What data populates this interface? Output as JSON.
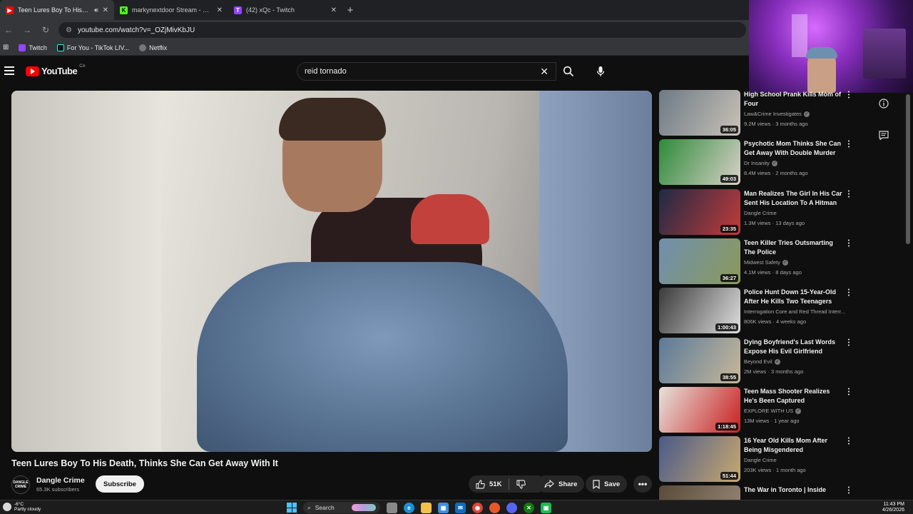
{
  "browser": {
    "tabs": [
      {
        "title": "Teen Lures Boy To His Death",
        "active": true,
        "icon": "youtube-favicon",
        "color": "#ff0000"
      },
      {
        "title": "markynextdoor Stream - Watch",
        "active": false,
        "icon": "kick-favicon",
        "color": "#53fc18"
      },
      {
        "title": "(42) xQc - Twitch",
        "active": false,
        "icon": "twitch-favicon",
        "color": "#9146ff"
      }
    ],
    "url": "youtube.com/watch?v=_OZjMivKbJU",
    "bookmarks": [
      {
        "label": "Twitch",
        "color": "#9146ff"
      },
      {
        "label": "For You - TikTok LIV...",
        "color": "#25f4ee"
      },
      {
        "label": "Netflix",
        "color": "#e50914"
      }
    ]
  },
  "youtube": {
    "logo_text": "YouTube",
    "country": "CA",
    "search_value": "reid tornado"
  },
  "video": {
    "title": "Teen Lures Boy To His Death, Thinks She Can Get Away With It",
    "channel": "Dangle Crime",
    "avatar_text": "DANGLE CRIME",
    "subscribers": "65.3K subscribers",
    "subscribe_label": "Subscribe",
    "likes": "51K",
    "share_label": "Share",
    "save_label": "Save"
  },
  "recommendations": [
    {
      "title": "High School Prank Kills Mom of Four",
      "channel": "Law&Crime Investigates",
      "verified": true,
      "views": "9.2M views",
      "age": "3 months ago",
      "duration": "36:05",
      "thumb": [
        "#6d7a86",
        "#c9c2b7"
      ]
    },
    {
      "title": "Psychotic Mom Thinks She Can Get Away With Double Murder",
      "channel": "Dr Insanity",
      "verified": true,
      "views": "8.4M views",
      "age": "2 months ago",
      "duration": "49:03",
      "thumb": [
        "#2e8b3a",
        "#d8d0c8"
      ]
    },
    {
      "title": "Man Realizes The Girl In His Car Sent His Location To A Hitman",
      "channel": "Dangle Crime",
      "verified": false,
      "views": "1.3M views",
      "age": "13 days ago",
      "duration": "23:35",
      "thumb": [
        "#1e2a44",
        "#c23b3b"
      ]
    },
    {
      "title": "Teen Killer Tries Outsmarting The Police",
      "channel": "Midwest Safety",
      "verified": true,
      "views": "4.1M views",
      "age": "8 days ago",
      "duration": "36:27",
      "thumb": [
        "#6f8fb0",
        "#8b9a5a"
      ]
    },
    {
      "title": "Police Hunt Down 15-Year-Old After He Kills Two Teenagers",
      "channel": "Interrogation Core and Red Thread Interr...",
      "verified": false,
      "views": "806K views",
      "age": "4 weeks ago",
      "duration": "1:00:43",
      "thumb": [
        "#3a3a3a",
        "#e0e0e0"
      ]
    },
    {
      "title": "Dying Boyfriend's Last Words Expose His Evil Girlfriend",
      "channel": "Beyond Evil",
      "verified": true,
      "views": "2M views",
      "age": "3 months ago",
      "duration": "38:55",
      "thumb": [
        "#5a7a9a",
        "#c8b89a"
      ]
    },
    {
      "title": "Teen Mass Shooter Realizes He's Been Captured",
      "channel": "EXPLORE WITH US",
      "verified": true,
      "views": "13M views",
      "age": "1 year ago",
      "duration": "1:18:45",
      "thumb": [
        "#e7e2dc",
        "#c82020"
      ]
    },
    {
      "title": "16 Year Old Kills Mom After Being Misgendered",
      "channel": "Dangle Crime",
      "verified": false,
      "views": "203K views",
      "age": "1 month ago",
      "duration": "51:44",
      "thumb": [
        "#4a5a8a",
        "#c8a870"
      ]
    },
    {
      "title": "The War in Toronto | Inside",
      "channel": "",
      "verified": false,
      "views": "",
      "age": "",
      "duration": "",
      "thumb": [
        "#5a4a3a",
        "#9a8a7a"
      ]
    }
  ],
  "taskbar": {
    "temperature": "-6°C",
    "weather": "Partly cloudy",
    "search_label": "Search",
    "time": "11:43 PM",
    "date": "4/26/2026"
  }
}
